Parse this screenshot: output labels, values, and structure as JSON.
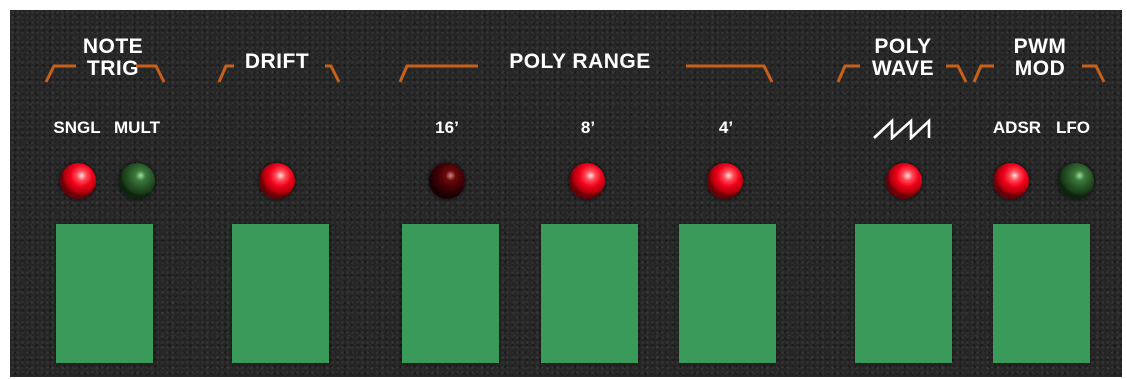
{
  "panel": {
    "groups": [
      {
        "id": "note-trig",
        "title": "NOTE\nTRIG",
        "labels": [
          "SNGL",
          "MULT"
        ]
      },
      {
        "id": "drift",
        "title": "DRIFT",
        "labels": []
      },
      {
        "id": "poly-range",
        "title": "POLY RANGE",
        "labels": [
          "16’",
          "8’",
          "4’"
        ]
      },
      {
        "id": "poly-wave",
        "title": "POLY\nWAVE",
        "labels": []
      },
      {
        "id": "pwm-mod",
        "title": "PWM\nMOD",
        "labels": [
          "ADSR",
          "LFO"
        ]
      }
    ],
    "icons": {
      "poly_wave": "sawtooth-wave-icon"
    },
    "leds": [
      {
        "name": "note-trig-sngl",
        "state": "on",
        "color": "#f0001a"
      },
      {
        "name": "note-trig-mult",
        "state": "off",
        "color": "#2a5a2a"
      },
      {
        "name": "drift",
        "state": "on",
        "color": "#f0001a"
      },
      {
        "name": "poly-range-16",
        "state": "dim",
        "color": "#4a0206"
      },
      {
        "name": "poly-range-8",
        "state": "on",
        "color": "#f0001a"
      },
      {
        "name": "poly-range-4",
        "state": "on",
        "color": "#f0001a"
      },
      {
        "name": "poly-wave",
        "state": "on",
        "color": "#f0001a"
      },
      {
        "name": "pwm-mod-adsr",
        "state": "on",
        "color": "#f0001a"
      },
      {
        "name": "pwm-mod-lfo",
        "state": "off",
        "color": "#2a5a2a"
      }
    ],
    "colors": {
      "panel": "#262626",
      "bracket": "#c8601a",
      "button": "#3a9a5a",
      "text": "#ffffff"
    }
  }
}
